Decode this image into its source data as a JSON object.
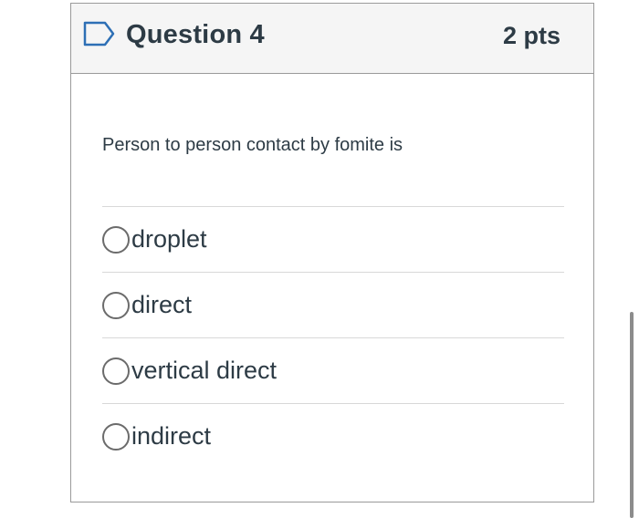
{
  "question": {
    "title": "Question 4",
    "points": "2 pts",
    "prompt": "Person to person contact by fomite is",
    "flag_icon": "bookmark-flag-icon"
  },
  "answers": [
    {
      "label": "droplet",
      "selected": false
    },
    {
      "label": "direct",
      "selected": false
    },
    {
      "label": "vertical direct",
      "selected": false
    },
    {
      "label": "indirect",
      "selected": false
    }
  ],
  "colors": {
    "text": "#2d3b45",
    "header_bg": "#f5f5f5",
    "border": "#9a9a9a",
    "flag": "#2d6fb5"
  }
}
